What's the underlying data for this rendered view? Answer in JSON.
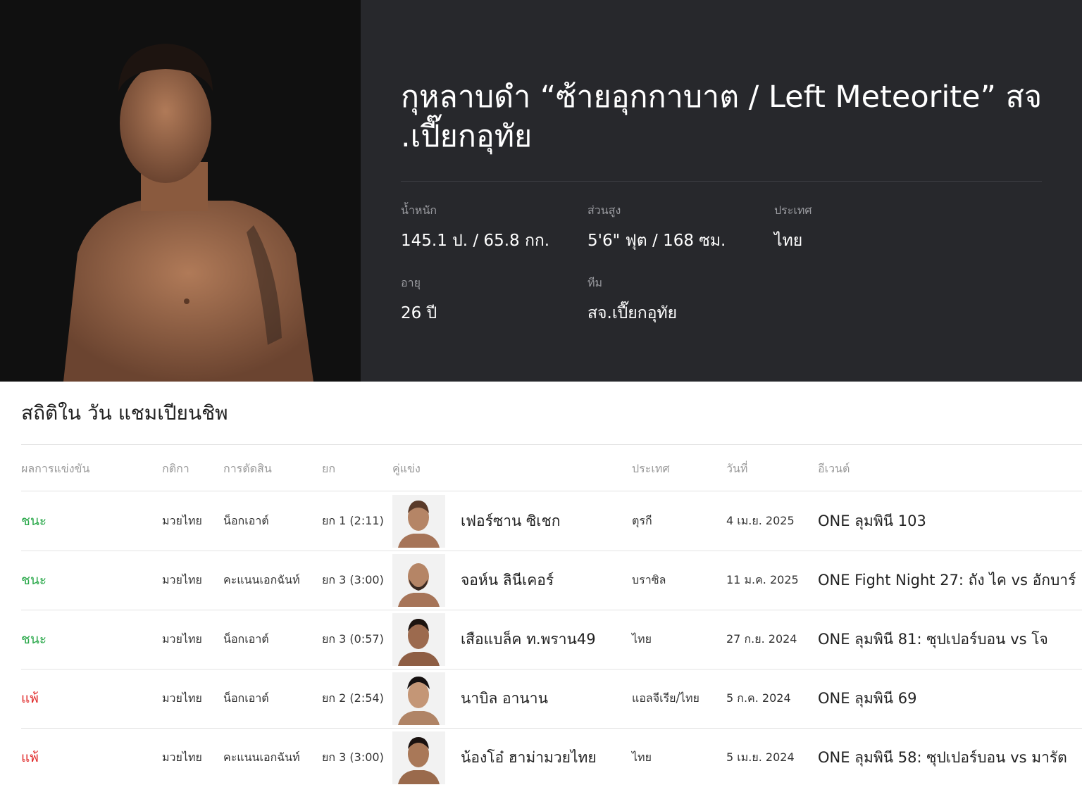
{
  "fighter": {
    "name": "กุหลาบดำ “ซ้ายอุกกาบาต / Left Meteorite” สจ.เปี๊ยกอุทัย",
    "name_line1": "กุหลาบดำ “ซ้ายอุกกาบาต / Left Meteorite” สจ",
    "name_line2": ".เปี๊ยกอุทัย",
    "stats": {
      "weight_label": "น้ำหนัก",
      "weight_value": "145.1 ป. / 65.8 กก.",
      "height_label": "ส่วนสูง",
      "height_value": "5'6\" ฟุต / 168 ซม.",
      "country_label": "ประเทศ",
      "country_value": "ไทย",
      "age_label": "อายุ",
      "age_value": "26 ปี",
      "team_label": "ทีม",
      "team_value": "สจ.เปี๊ยกอุทัย"
    }
  },
  "record": {
    "title": "สถิติใน วัน แชมเปียนชิพ",
    "headers": {
      "result": "ผลการแข่งขัน",
      "rules": "กติกา",
      "method": "การตัดสิน",
      "round": "ยก",
      "opponent": "คู่แข่ง",
      "country": "ประเทศ",
      "date": "วันที่",
      "event": "อีเวนต์"
    },
    "rows": [
      {
        "result": "ชนะ",
        "rules": "มวยไทย",
        "method": "น็อกเอาต์",
        "round": "ยก 1 (2:11)",
        "opponent": "เฟอร์ซาน ซิเชก",
        "country": "ตุรกี",
        "date": "4 เม.ย. 2025",
        "event": "ONE ลุมพินี 103"
      },
      {
        "result": "ชนะ",
        "rules": "มวยไทย",
        "method": "คะแนนเอกฉันท์",
        "round": "ยก 3 (3:00)",
        "opponent": "จอห์น ลินีเคอร์",
        "country": "บราซิล",
        "date": "11 ม.ค. 2025",
        "event": "ONE Fight Night 27: ถัง ไค vs อักบาร์"
      },
      {
        "result": "ชนะ",
        "rules": "มวยไทย",
        "method": "น็อกเอาต์",
        "round": "ยก 3 (0:57)",
        "opponent": "เสือแบล็ค ท.พราน49",
        "country": "ไทย",
        "date": "27 ก.ย. 2024",
        "event": "ONE ลุมพินี 81: ซุปเปอร์บอน vs โจ"
      },
      {
        "result": "แพ้",
        "rules": "มวยไทย",
        "method": "น็อกเอาต์",
        "round": "ยก 2 (2:54)",
        "opponent": "นาบิล อานาน",
        "country": "แอลจีเรีย/ไทย",
        "date": "5 ก.ค. 2024",
        "event": "ONE ลุมพินี 69"
      },
      {
        "result": "แพ้",
        "rules": "มวยไทย",
        "method": "คะแนนเอกฉันท์",
        "round": "ยก 3 (3:00)",
        "opponent": "น้องโอ๋ ฮาม่ามวยไทย",
        "country": "ไทย",
        "date": "5 เม.ย. 2024",
        "event": "ONE ลุมพินี 58: ซุปเปอร์บอน vs มารัต"
      }
    ]
  },
  "colors": {
    "win": "#2aa84a",
    "loss": "#e02a2a",
    "hero_bg": "#27282c"
  }
}
